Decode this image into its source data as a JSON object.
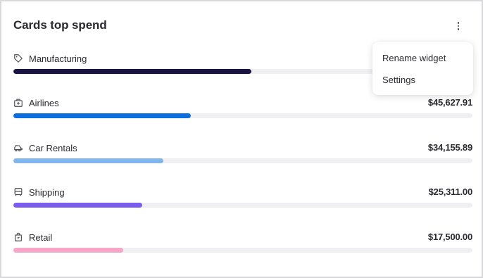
{
  "widget": {
    "title": "Cards top spend",
    "menu_icon": "more-vertical-icon"
  },
  "rows": [
    {
      "label": "Manufacturing",
      "amount": "",
      "icon": "tag-icon",
      "fraction": 0.518,
      "color": "#1a1445"
    },
    {
      "label": "Airlines",
      "amount": "$45,627.91",
      "icon": "luggage-icon",
      "fraction": 0.387,
      "color": "#0a6fdc"
    },
    {
      "label": "Car Rentals",
      "amount": "$34,155.89",
      "icon": "car-icon",
      "fraction": 0.327,
      "color": "#80b6ec"
    },
    {
      "label": "Shipping",
      "amount": "$25,311.00",
      "icon": "truck-icon",
      "fraction": 0.281,
      "color": "#7a5cf0"
    },
    {
      "label": "Retail",
      "amount": "$17,500.00",
      "icon": "shopping-bag-icon",
      "fraction": 0.24,
      "color": "#f7a5c8"
    }
  ],
  "menu": {
    "items": [
      "Rename widget",
      "Settings"
    ]
  }
}
